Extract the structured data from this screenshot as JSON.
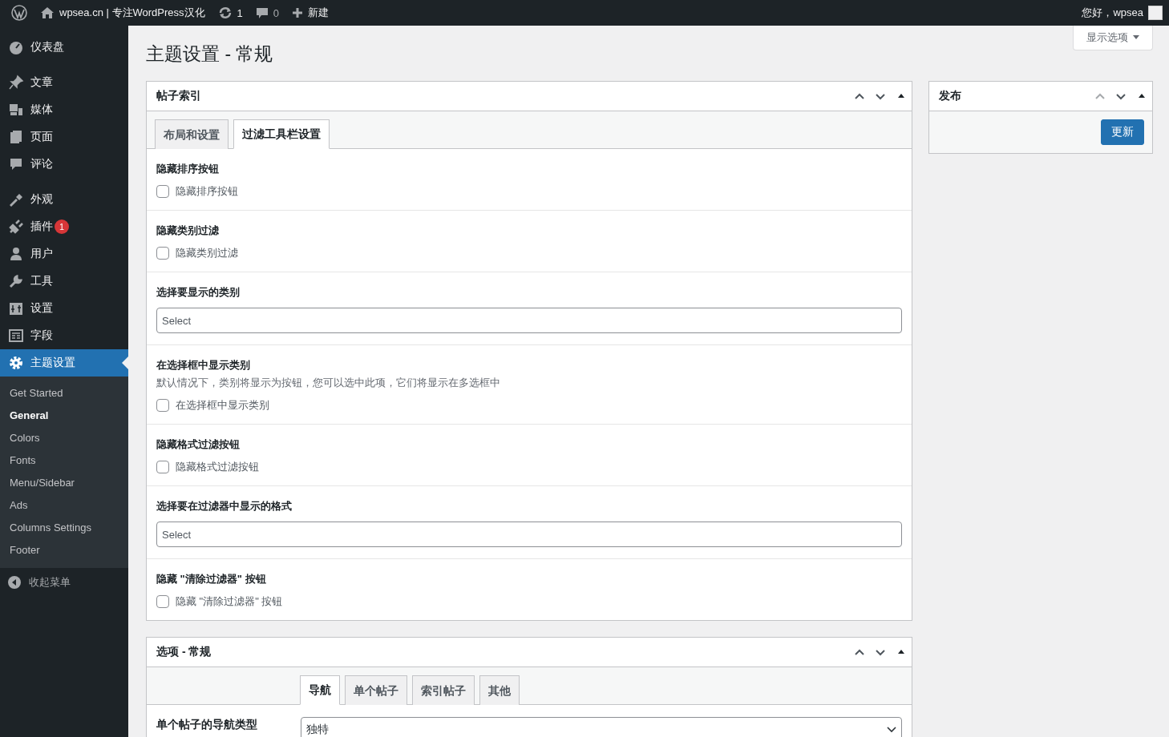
{
  "admin_bar": {
    "site_name": "wpsea.cn | 专注WordPress汉化",
    "updates_count": "1",
    "comments_count": "0",
    "new_label": "新建",
    "greeting": "您好，wpsea"
  },
  "sidebar": {
    "groups": [
      [
        {
          "label": "仪表盘",
          "selected": false
        }
      ],
      [
        {
          "label": "文章",
          "selected": false
        },
        {
          "label": "媒体",
          "selected": false
        },
        {
          "label": "页面",
          "selected": false
        },
        {
          "label": "评论",
          "selected": false
        }
      ],
      [
        {
          "label": "外观",
          "selected": false
        },
        {
          "label": "插件",
          "selected": false,
          "badge": "1"
        },
        {
          "label": "用户",
          "selected": false
        },
        {
          "label": "工具",
          "selected": false
        },
        {
          "label": "设置",
          "selected": false
        },
        {
          "label": "字段",
          "selected": false
        },
        {
          "label": "主题设置",
          "selected": true
        }
      ]
    ],
    "submenu": [
      {
        "label": "Get Started",
        "selected": false
      },
      {
        "label": "General",
        "selected": true
      },
      {
        "label": "Colors",
        "selected": false
      },
      {
        "label": "Fonts",
        "selected": false
      },
      {
        "label": "Menu/Sidebar",
        "selected": false
      },
      {
        "label": "Ads",
        "selected": false
      },
      {
        "label": "Columns Settings",
        "selected": false
      },
      {
        "label": "Footer",
        "selected": false
      }
    ],
    "collapse_label": "收起菜单"
  },
  "screen_options": "显示选项",
  "page_title": "主题设置 - 常规",
  "post_index_box": {
    "title": "帖子索引",
    "tabs": [
      {
        "label": "布局和设置",
        "selected": false
      },
      {
        "label": "过滤工具栏设置",
        "selected": true
      }
    ],
    "settings": [
      {
        "kind": "checkbox",
        "title": "隐藏排序按钮",
        "label": "隐藏排序按钮",
        "checked": false
      },
      {
        "kind": "checkbox",
        "title": "隐藏类别过滤",
        "label": "隐藏类别过滤",
        "checked": false
      },
      {
        "kind": "select",
        "title": "选择要显示的类别",
        "placeholder": "Select"
      },
      {
        "kind": "checkbox",
        "title": "在选择框中显示类别",
        "description": "默认情况下，类别将显示为按钮，您可以选中此项，它们将显示在多选框中",
        "label": "在选择框中显示类别",
        "checked": false
      },
      {
        "kind": "checkbox",
        "title": "隐藏格式过滤按钮",
        "label": "隐藏格式过滤按钮",
        "checked": false
      },
      {
        "kind": "select",
        "title": "选择要在过滤器中显示的格式",
        "placeholder": "Select"
      },
      {
        "kind": "checkbox",
        "title": "隐藏 \"清除过滤器\" 按钮",
        "label": "隐藏 \"清除过滤器\" 按钮",
        "checked": false
      }
    ]
  },
  "options_box": {
    "title": "选项 - 常规",
    "tabs": [
      {
        "label": "导航",
        "selected": true
      },
      {
        "label": "单个帖子",
        "selected": false
      },
      {
        "label": "索引帖子",
        "selected": false
      },
      {
        "label": "其他",
        "selected": false
      }
    ],
    "field_label": "单个帖子的导航类型",
    "field_value": "独特"
  },
  "publish_box": {
    "title": "发布",
    "button": "更新"
  }
}
